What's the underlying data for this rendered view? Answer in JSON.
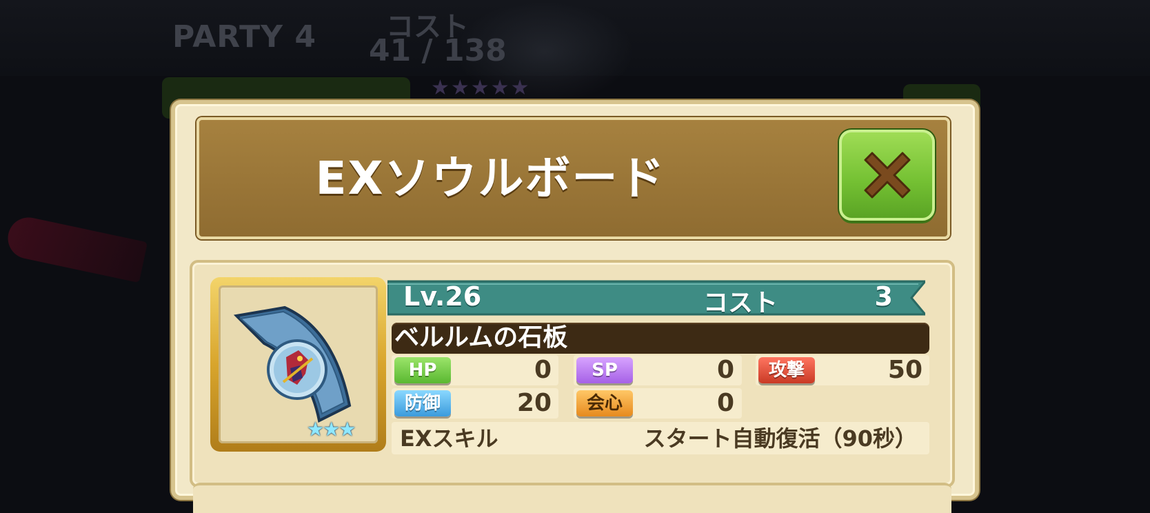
{
  "background": {
    "party_title": "PARTY 4",
    "cost_label": "コスト",
    "cost_value": "41 / 138",
    "stars": "★★★★★"
  },
  "dialog": {
    "title": "EXソウルボード",
    "close_icon": "close-x-icon"
  },
  "item": {
    "level": "Lv.26",
    "cost_label": "コスト",
    "cost_value": "3",
    "name": "ベルルムの石板",
    "rarity_stars": "★★★",
    "stats": {
      "hp": {
        "label": "HP",
        "value": "0"
      },
      "sp": {
        "label": "SP",
        "value": "0"
      },
      "atk": {
        "label": "攻撃",
        "value": "50"
      },
      "def": {
        "label": "防御",
        "value": "20"
      },
      "crit": {
        "label": "会心",
        "value": "0"
      }
    },
    "ex_skill": {
      "label": "EXスキル",
      "value": "スタート自動復活（90秒）"
    }
  },
  "colors": {
    "title_bar": "#9a7838",
    "close_button": "#76c234",
    "ribbon": "#3b8a82",
    "name_bar": "#3d2a14"
  }
}
